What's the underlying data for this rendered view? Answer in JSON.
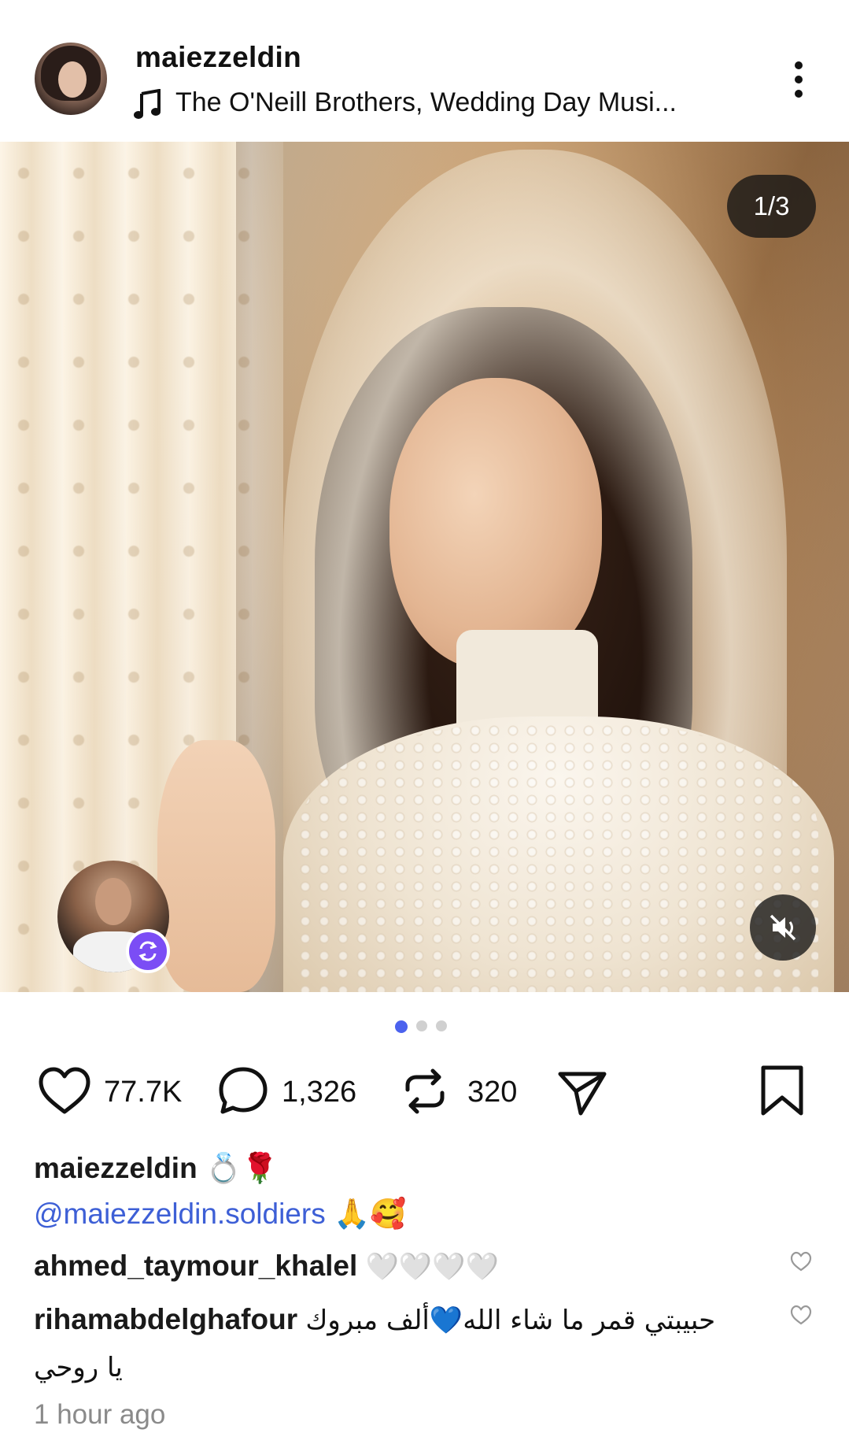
{
  "post": {
    "username": "maiezzeldin",
    "music": "The O'Neill Brothers, Wedding Day Musi...",
    "image_counter": "1/3",
    "current_image": 1,
    "total_images": 3
  },
  "stats": {
    "likes": "77.7K",
    "comments": "1,326",
    "reposts": "320"
  },
  "caption": {
    "username": "maiezzeldin",
    "emojis": "💍🌹",
    "mention": "@maiezzeldin.soldiers",
    "mention_emojis": "🙏🥰"
  },
  "comments": [
    {
      "username": "ahmed_taymour_khalel",
      "text": "🤍🤍🤍🤍"
    },
    {
      "username": "rihamabdelghafour",
      "text": "حبيبتي قمر ما شاء الله💙ألف مبروك",
      "text_line2": "يا روحي"
    }
  ],
  "timestamp": "1 hour ago",
  "colors": {
    "accent": "#4b62ee",
    "mention": "#3d5fd6",
    "repost_badge": "#7b4df5",
    "muted_text": "#8a8a8a"
  },
  "icons": [
    "music-note-icon",
    "more-icon",
    "repost-icon",
    "mute-icon",
    "heart-icon",
    "comment-icon",
    "repost-icon",
    "share-icon",
    "bookmark-icon",
    "heart-outline-icon"
  ]
}
